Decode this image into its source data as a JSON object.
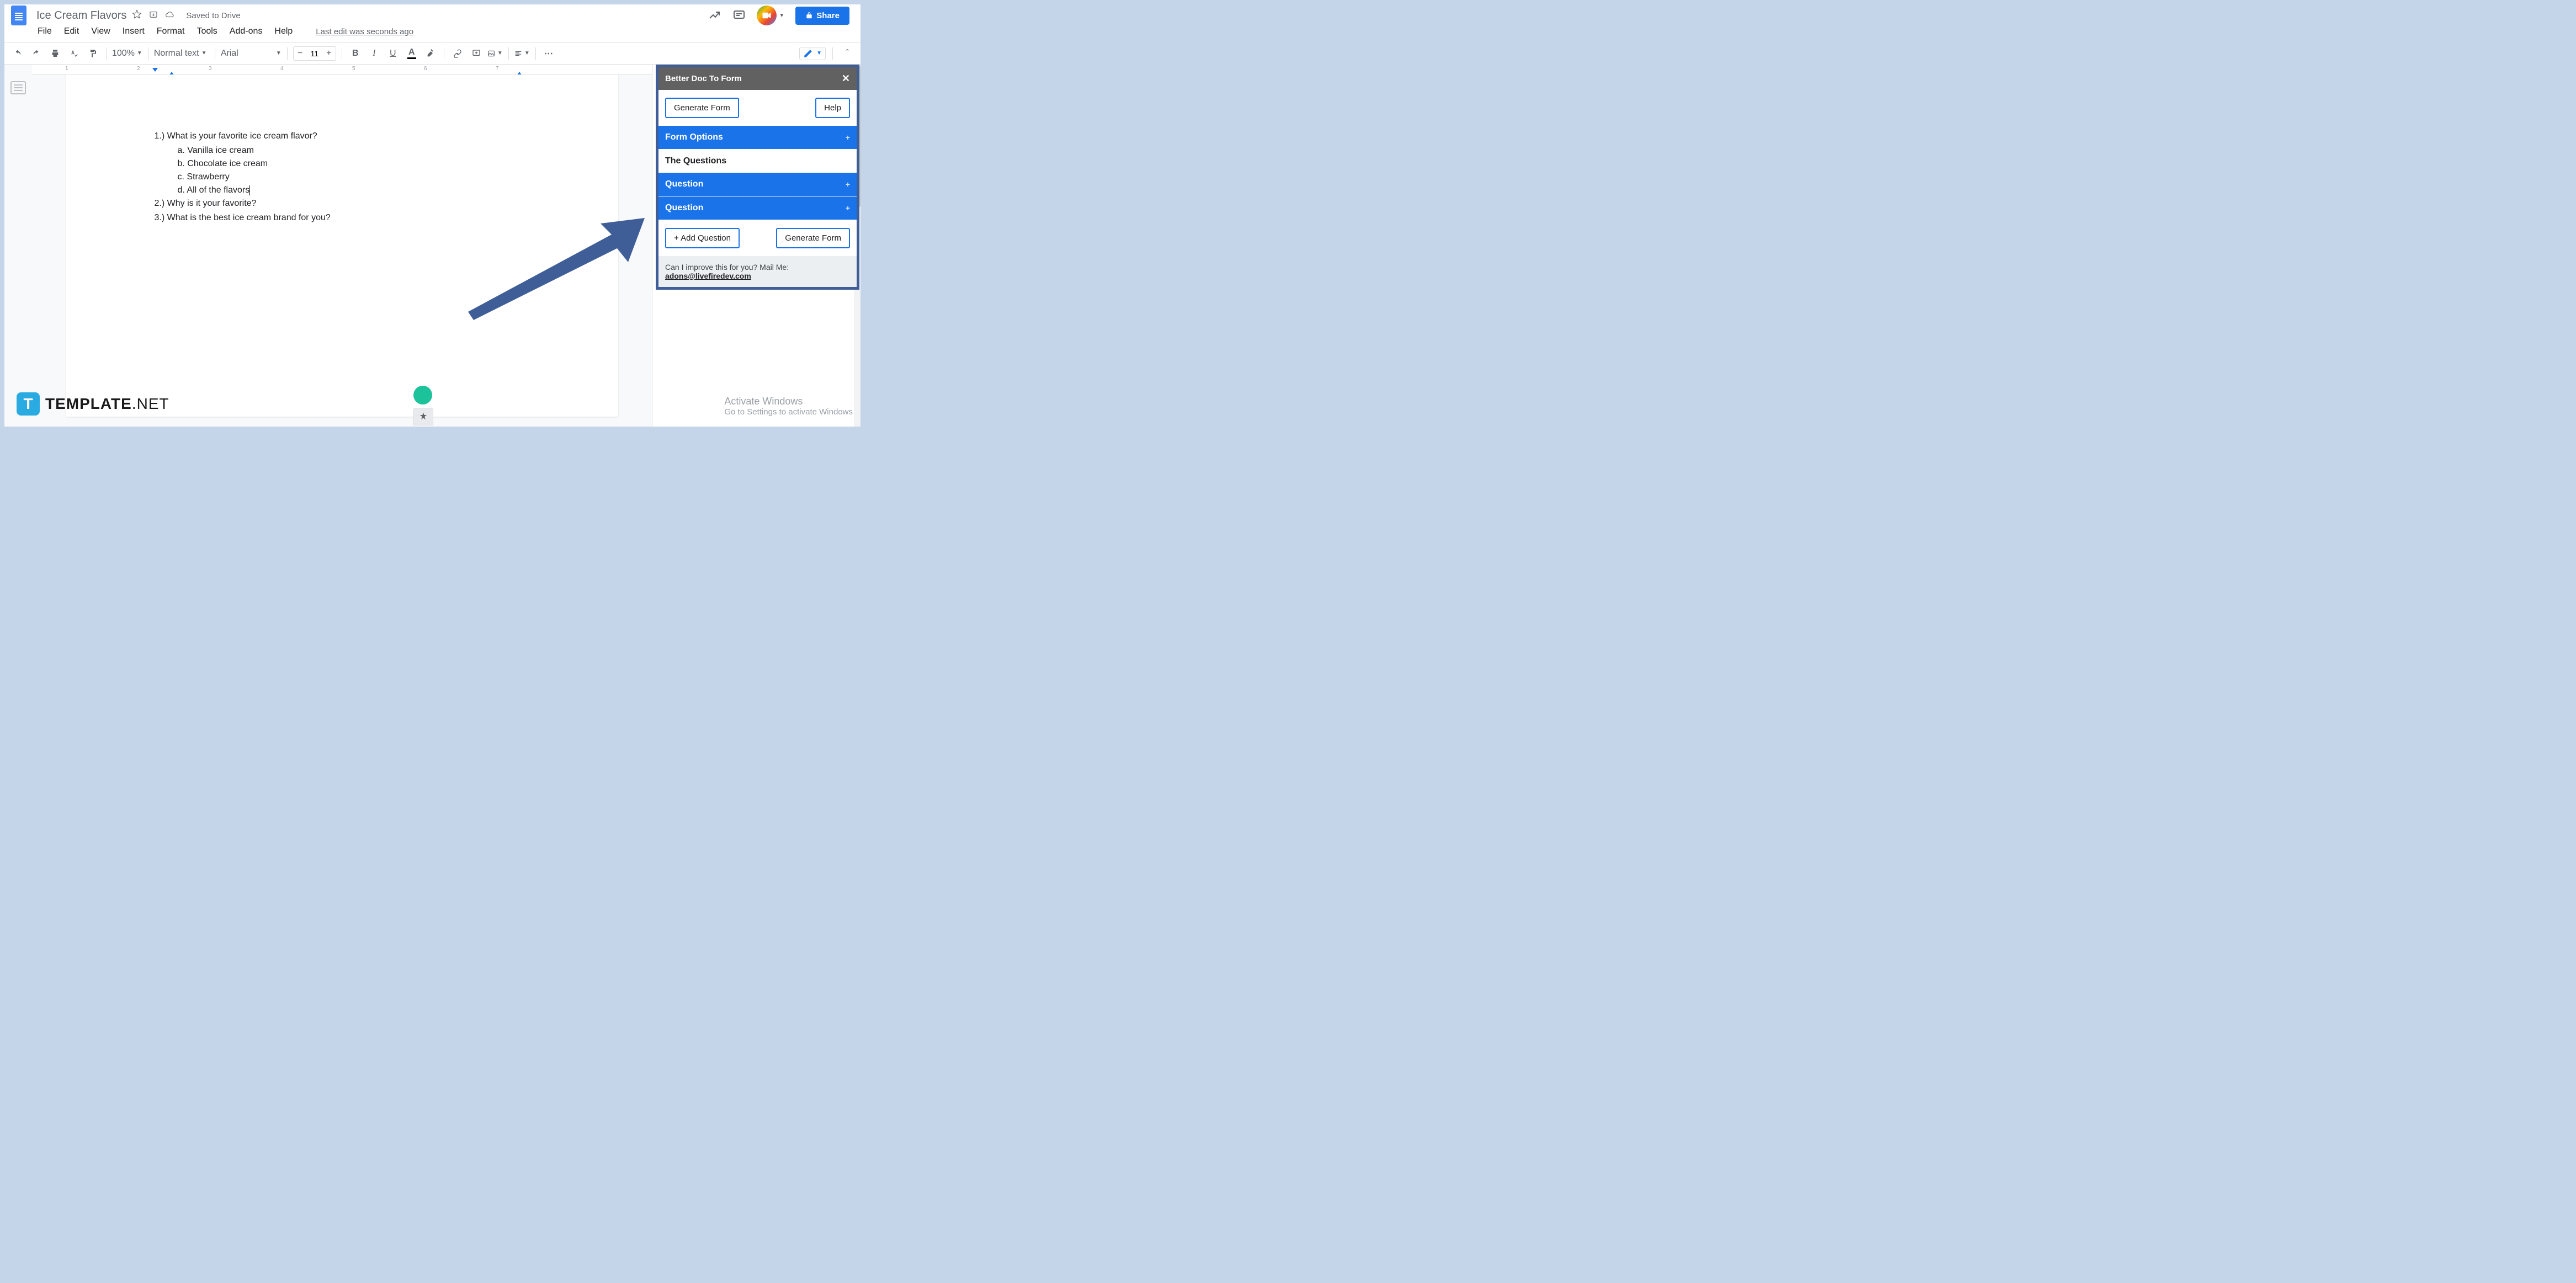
{
  "header": {
    "doc_title": "Ice Cream Flavors",
    "saved_status": "Saved to Drive",
    "share_label": "Share"
  },
  "menu": {
    "file": "File",
    "edit": "Edit",
    "view": "View",
    "insert": "Insert",
    "format": "Format",
    "tools": "Tools",
    "addons": "Add-ons",
    "help": "Help",
    "last_edit": "Last edit was seconds ago"
  },
  "toolbar": {
    "zoom": "100%",
    "style": "Normal text",
    "font": "Arial",
    "font_size": "11"
  },
  "ruler": {
    "marks": [
      "1",
      "2",
      "3",
      "4",
      "5",
      "6",
      "7"
    ]
  },
  "document": {
    "q1": "1.)  What is your favorite ice cream flavor?",
    "q1a": "a.   Vanilla ice cream",
    "q1b": "b.   Chocolate ice cream",
    "q1c": "c.   Strawberry",
    "q1d": "d.   All of the flavors",
    "q2": "2.)  Why is it your favorite?",
    "q3": "3.)  What is the best ice cream brand for you?"
  },
  "sidepanel": {
    "title": "Better Doc To Form",
    "generate": "Generate Form",
    "help": "Help",
    "form_options": "Form Options",
    "the_questions": "The Questions",
    "question": "Question",
    "add_question": "+ Add Question",
    "generate2": "Generate Form",
    "footer_text": "Can I improve this for you? Mail Me:",
    "footer_email": "adons@livefiredev.com"
  },
  "watermark": {
    "icon_letter": "T",
    "brand_bold": "TEMPLATE",
    "brand_light": ".NET"
  },
  "activate": {
    "line1": "Activate Windows",
    "line2": "Go to Settings to activate Windows"
  }
}
